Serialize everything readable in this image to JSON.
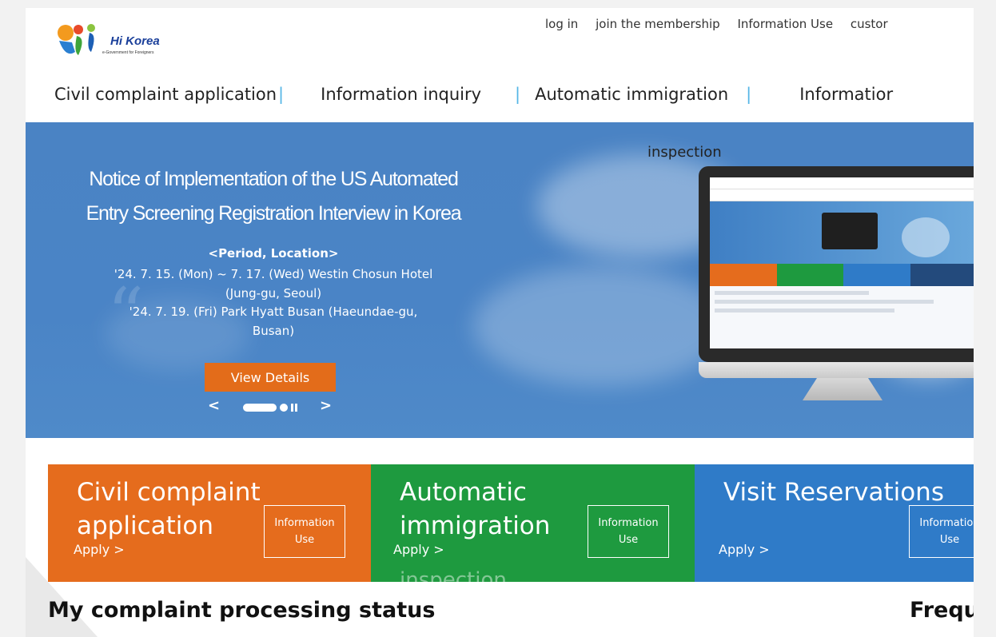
{
  "header": {
    "logo_text": "Hi Korea",
    "logo_sub": "e-Government for Foreigners",
    "utility_links": [
      "log in",
      "join the membership",
      "Information Use",
      "custor"
    ]
  },
  "nav": {
    "items": [
      "Civil complaint application",
      "Information inquiry",
      "Automatic immigration",
      "Informatior"
    ]
  },
  "banner": {
    "title_line1": "Notice of Implementation of the US Automated",
    "title_line2": "Entry Screening Registration Interview in Korea",
    "subtitle": "<Period, Location>",
    "line1": "'24. 7. 15. (Mon) ~ 7. 17. (Wed) Westin Chosun Hotel",
    "line2": "(Jung-gu, Seoul)",
    "line3": "'24. 7. 19. (Fri) Park Hyatt Busan (Haeundae-gu,",
    "line4": "Busan)",
    "button": "View Details",
    "overflow_label": "inspection",
    "prev_arrow": "<",
    "next_arrow": ">"
  },
  "tiles": [
    {
      "title_line1": "Civil complaint",
      "title_line2": "application",
      "apply": "Apply >",
      "info_line1": "Information",
      "info_line2": "Use",
      "color": "#e56c1d"
    },
    {
      "title_line1": "Automatic",
      "title_line2": "immigration",
      "title_line3": "inspection",
      "apply": "Apply >",
      "info_line1": "Information",
      "info_line2": "Use",
      "color": "#1e9a3f"
    },
    {
      "title_line1": "Visit Reservations",
      "apply": "Apply >",
      "info_line1": "Information",
      "info_line2": "Use",
      "color": "#2f7bc8"
    }
  ],
  "sections": {
    "left_title": "My complaint processing status",
    "right_title": "Frequ"
  }
}
